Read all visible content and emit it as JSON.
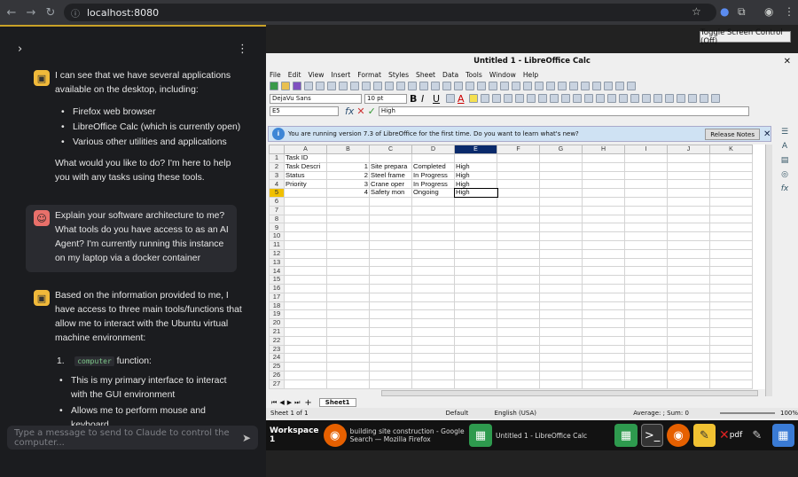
{
  "browser": {
    "url": "localhost:8080"
  },
  "toggle_label": "Toggle Screen Control (Off)",
  "chat": {
    "m1_intro": "I can see that we have several applications available on the desktop, including:",
    "m1_items": [
      "Firefox web browser",
      "LibreOffice Calc (which is currently open)",
      "Various other utilities and applications"
    ],
    "m1_outro": "What would you like to do? I'm here to help you with any tasks using these tools.",
    "user_msg": "Explain your software architecture to me? What tools do you have access to as an AI Agent? I'm currently running this instance on my laptop via a docker container",
    "m2_intro": "Based on the information provided to me, I have access to three main tools/functions that allow me to interact with the Ubuntu virtual machine environment:",
    "m2_num": "1.",
    "m2_code": "computer",
    "m2_code_suffix": "function:",
    "m2_items": [
      "This is my primary interface to interact with the GUI environment",
      "Allows me to perform mouse and keyboard"
    ],
    "input_placeholder": "Type a message to send to Claude to control the computer..."
  },
  "calc": {
    "title": "Untitled 1 - LibreOffice Calc",
    "menu": [
      "File",
      "Edit",
      "View",
      "Insert",
      "Format",
      "Styles",
      "Sheet",
      "Data",
      "Tools",
      "Window",
      "Help"
    ],
    "font_name": "DejaVu Sans",
    "font_size": "10 pt",
    "cell_ref": "E5",
    "formula": "High",
    "info": "You are running version 7.3 of LibreOffice for the first time. Do you want to learn what's new?",
    "release_notes": "Release Notes",
    "columns": [
      "A",
      "B",
      "C",
      "D",
      "E",
      "F",
      "G",
      "H",
      "I",
      "J",
      "K"
    ],
    "rows": [
      [
        "Task ID",
        "",
        "",
        "",
        ""
      ],
      [
        "Task Descri",
        "1",
        "Site prepara",
        "Completed",
        "High"
      ],
      [
        "Status",
        "2",
        "Steel frame",
        "In Progress",
        "High"
      ],
      [
        "Priority",
        "3",
        "Crane oper",
        "In Progress",
        "High"
      ],
      [
        "",
        "4",
        "Safety mon",
        "Ongoing",
        "High"
      ]
    ],
    "row_count": 27,
    "sheet_tab": "Sheet1",
    "status": {
      "sheet": "Sheet 1 of 1",
      "style": "Default",
      "lang": "English (USA)",
      "sum": "Average: ; Sum: 0",
      "zoom": "100%"
    }
  },
  "taskbar": {
    "workspace": "Workspace 1",
    "firefox_title": "building site construction - Google Search — Mozilla Firefox",
    "calc_title": "Untitled 1 - LibreOffice Calc",
    "pdf_label": "pdf"
  }
}
